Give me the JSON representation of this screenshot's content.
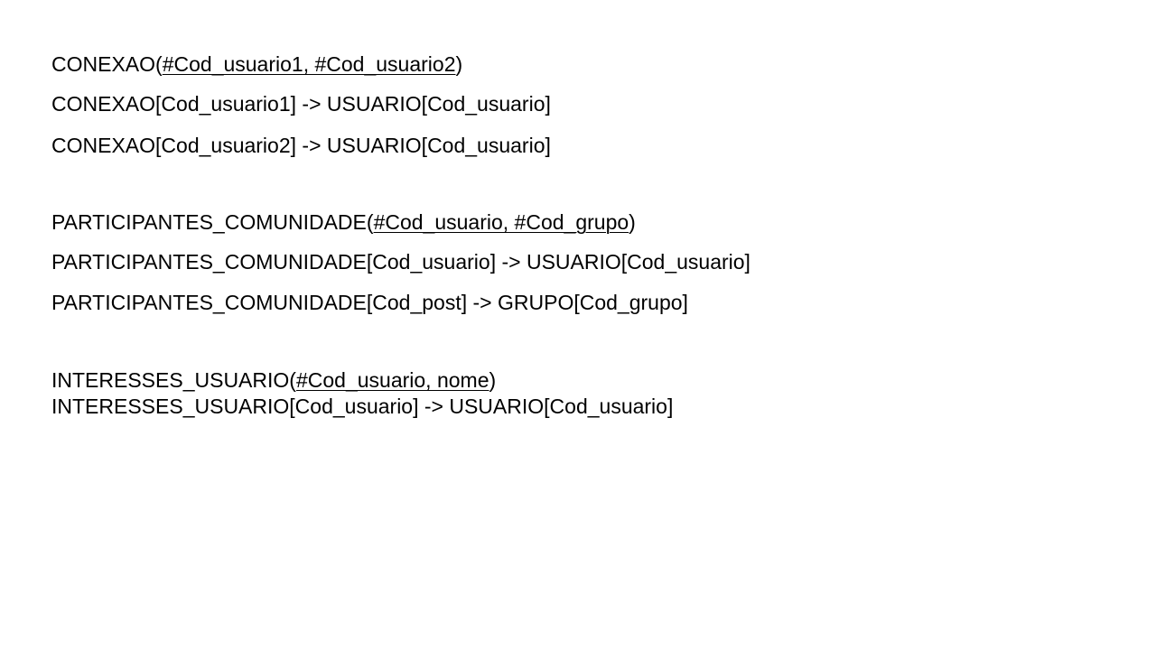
{
  "relations": [
    {
      "definition": {
        "name": "CONEXAO",
        "open": "(",
        "keys": "#Cod_usuario1, #Cod_usuario2",
        "close": ")"
      },
      "foreign_keys": [
        "CONEXAO[Cod_usuario1] -> USUARIO[Cod_usuario]",
        "CONEXAO[Cod_usuario2] -> USUARIO[Cod_usuario]"
      ]
    },
    {
      "definition": {
        "name": "PARTICIPANTES_COMUNIDADE",
        "open": "(",
        "keys": "#Cod_usuario, #Cod_grupo",
        "close": ")"
      },
      "foreign_keys": [
        "PARTICIPANTES_COMUNIDADE[Cod_usuario] -> USUARIO[Cod_usuario]",
        "PARTICIPANTES_COMUNIDADE[Cod_post] -> GRUPO[Cod_grupo]"
      ]
    },
    {
      "definition": {
        "name": "INTERESSES_USUARIO",
        "open": "(",
        "keys": "#Cod_usuario, nome",
        "close": ")"
      },
      "foreign_keys": [
        "INTERESSES_USUARIO[Cod_usuario] -> USUARIO[Cod_usuario]"
      ]
    }
  ]
}
